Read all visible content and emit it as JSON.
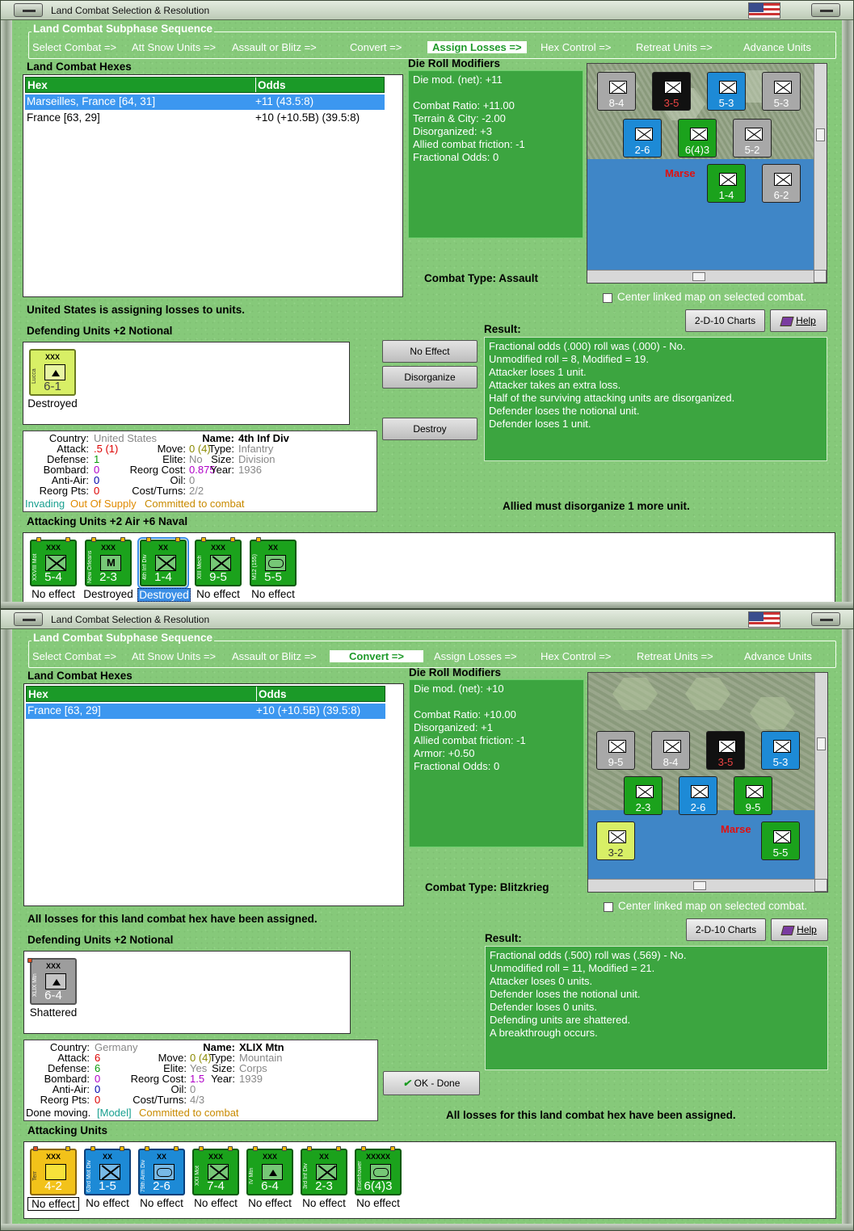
{
  "window_title": "Land Combat Selection & Resolution",
  "panels": [
    {
      "sequence_title": "Land Combat Subphase Sequence",
      "sequence": [
        "Select Combat =>",
        "Att Snow Units =>",
        "Assault or Blitz =>",
        "Convert =>",
        "Assign Losses =>",
        "Hex Control =>",
        "Retreat Units =>",
        "Advance Units"
      ],
      "active_step": "Assign Losses =>",
      "hexes_label": "Land Combat Hexes",
      "col_hex": "Hex",
      "col_odds": "Odds",
      "hex_rows": [
        {
          "hex": "Marseilles, France [64, 31]",
          "odds": "+11 (43.5:8)"
        },
        {
          "hex": "France [63, 29]",
          "odds": "+10 (+10.5B) (39.5:8)"
        }
      ],
      "drm_label": "Die Roll Modifiers",
      "drm_lines": [
        "Die mod. (net): +11",
        "",
        "Combat Ratio: +11.00",
        "Terrain & City: -2.00",
        "Disorganized: +3",
        "Allied combat friction: -1",
        "Fractional Odds: 0"
      ],
      "combat_type": "Combat Type:  Assault",
      "center_map_label": "Center linked map on selected combat.",
      "charts_btn": "2-D-10 Charts",
      "help_btn": "Help",
      "status_msg": "United States is assigning losses to units.",
      "defending_label": "Defending Units +2 Notional",
      "defending_units": [
        {
          "name": "Lucca",
          "size": "XXX",
          "str": "6-1",
          "label": "Destroyed"
        }
      ],
      "buttons": [
        "No Effect",
        "Disorganize",
        "Destroy"
      ],
      "result_label": "Result:",
      "result_lines": [
        "Fractional odds (.000) roll was (.000)  - No.",
        "Unmodified roll = 8, Modified = 19.",
        "Attacker loses 1 unit.",
        "Attacker takes an extra loss.",
        "Half of the surviving attacking units are disorganized.",
        "Defender loses the notional unit.",
        "Defender loses 1 unit."
      ],
      "footer_msg": "Allied must disorganize 1 more unit.",
      "info": {
        "country_k": "Country:",
        "country_v": "United States",
        "attack_k": "Attack:",
        "attack_v": ".5 (1)",
        "defense_k": "Defense:",
        "defense_v": "1",
        "bombard_k": "Bombard:",
        "bombard_v": "0",
        "antiair_k": "Anti-Air:",
        "antiair_v": "0",
        "reorgpts_k": "Reorg Pts:",
        "reorgpts_v": "0",
        "name_k": "Name:",
        "name_v": "4th Inf Div",
        "move_k": "Move:",
        "move_v": "0 (4)",
        "type_k": "Type:",
        "type_v": "Infantry",
        "elite_k": "Elite:",
        "elite_v": "No",
        "size_k": "Size:",
        "size_v": "Division",
        "reorgcost_k": "Reorg Cost:",
        "reorgcost_v": "0.875",
        "year_k": "Year:",
        "year_v": "1936",
        "oil_k": "Oil:",
        "oil_v": "0",
        "costturns_k": "Cost/Turns:",
        "costturns_v": "2/2",
        "status_a": "Invading",
        "status_b": "Out Of Supply",
        "status_c": "Committed to combat"
      },
      "attacking_label": "Attacking Units +2 Air +6 Naval",
      "attacking_units": [
        {
          "name": "XXVIII Mot",
          "size": "XXX",
          "str": "5-4",
          "label": "No effect"
        },
        {
          "name": "New Orleans",
          "size": "XXX",
          "str": "2-3",
          "label": "Destroyed"
        },
        {
          "name": "4th Inf Div",
          "size": "XX",
          "str": "1-4",
          "label": "Destroyed"
        },
        {
          "name": "XIII Mech",
          "size": "XXX",
          "str": "9-5",
          "label": "No effect"
        },
        {
          "name": "M12 (155)",
          "size": "XX",
          "str": "5-5",
          "label": "No effect"
        }
      ],
      "map_units": [
        {
          "str": "8-4"
        },
        {
          "str": "3-5"
        },
        {
          "str": "5-3"
        },
        {
          "str": "5-3"
        },
        {
          "str": "2-6"
        },
        {
          "str": "6(4)3"
        },
        {
          "str": "5-2"
        },
        {
          "str": "1-4"
        },
        {
          "str": "6-2"
        }
      ],
      "map_city": "Marse"
    },
    {
      "sequence_title": "Land Combat Subphase Sequence",
      "sequence": [
        "Select Combat =>",
        "Att Snow Units =>",
        "Assault or Blitz =>",
        "Convert =>",
        "Assign Losses =>",
        "Hex Control =>",
        "Retreat Units =>",
        "Advance Units"
      ],
      "active_step": "Convert =>",
      "hexes_label": "Land Combat Hexes",
      "col_hex": "Hex",
      "col_odds": "Odds",
      "hex_rows": [
        {
          "hex": "France [63, 29]",
          "odds": "+10 (+10.5B) (39.5:8)"
        }
      ],
      "drm_label": "Die Roll Modifiers",
      "drm_lines": [
        "Die mod. (net): +10",
        "",
        "Combat Ratio: +10.00",
        "Disorganized: +1",
        "Allied combat friction: -1",
        "Armor: +0.50",
        "Fractional Odds: 0"
      ],
      "combat_type": "Combat Type:  Blitzkrieg",
      "center_map_label": "Center linked map on selected combat.",
      "charts_btn": "2-D-10 Charts",
      "help_btn": "Help",
      "status_msg": "All losses for this land combat hex have been assigned.",
      "defending_label": "Defending Units +2 Notional",
      "defending_units": [
        {
          "name": "XLIX Mtn",
          "size": "XXX",
          "str": "6-4",
          "label": "Shattered"
        }
      ],
      "ok_btn": "OK - Done",
      "result_label": "Result:",
      "result_lines": [
        "Fractional odds (.500) roll was (.569)  - No.",
        "Unmodified roll = 11, Modified = 21.",
        "Attacker loses 0 units.",
        "Defender loses the notional unit.",
        "Defender loses 0 units.",
        "Defending units are shattered.",
        "A breakthrough occurs."
      ],
      "footer_msg": "All losses for this land combat hex have been assigned.",
      "info": {
        "country_k": "Country:",
        "country_v": "Germany",
        "attack_k": "Attack:",
        "attack_v": "6",
        "defense_k": "Defense:",
        "defense_v": "6",
        "bombard_k": "Bombard:",
        "bombard_v": "0",
        "antiair_k": "Anti-Air:",
        "antiair_v": "0",
        "reorgpts_k": "Reorg Pts:",
        "reorgpts_v": "0",
        "name_k": "Name:",
        "name_v": "XLIX Mtn",
        "move_k": "Move:",
        "move_v": "0 (4)",
        "type_k": "Type:",
        "type_v": "Mountain",
        "elite_k": "Elite:",
        "elite_v": "Yes",
        "size_k": "Size:",
        "size_v": "Corps",
        "reorgcost_k": "Reorg Cost:",
        "reorgcost_v": "1.5",
        "year_k": "Year:",
        "year_v": "1939",
        "oil_k": "Oil:",
        "oil_v": "0",
        "costturns_k": "Cost/Turns:",
        "costturns_v": "4/3",
        "status_a": "Done moving.",
        "status_b": "[Model]",
        "status_c": "Committed to combat"
      },
      "attacking_label": "Attacking Units",
      "attacking_units": [
        {
          "name": "Terr",
          "size": "XXX",
          "str": "4-2",
          "label": "No effect"
        },
        {
          "name": "63rd Mot Div",
          "size": "XX",
          "str": "1-5",
          "label": "No effect"
        },
        {
          "name": "79th Arm Div",
          "size": "XX",
          "str": "2-6",
          "label": "No effect"
        },
        {
          "name": "XXI Mot",
          "size": "XXX",
          "str": "7-4",
          "label": "No effect"
        },
        {
          "name": "IV Mtn",
          "size": "XXX",
          "str": "6-4",
          "label": "No effect"
        },
        {
          "name": "3rd Inf Div",
          "size": "XX",
          "str": "2-3",
          "label": "No effect"
        },
        {
          "name": "Eisenhower",
          "size": "XXXXX",
          "str": "6(4)3",
          "label": "No effect"
        }
      ],
      "map_units": [
        {
          "str": "9-5"
        },
        {
          "str": "8-4"
        },
        {
          "str": "3-5"
        },
        {
          "str": "5-3"
        },
        {
          "str": "2-3"
        },
        {
          "str": "2-6"
        },
        {
          "str": "9-5"
        },
        {
          "str": "3-2"
        },
        {
          "str": "5-5"
        }
      ],
      "map_city": "Marse"
    }
  ]
}
